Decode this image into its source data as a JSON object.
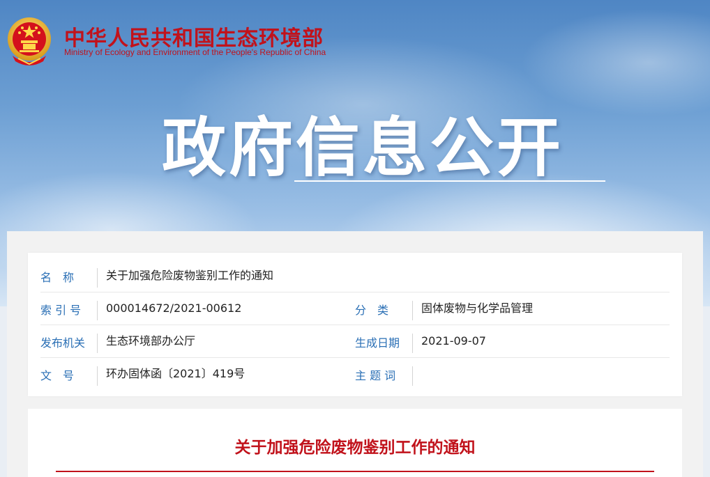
{
  "header": {
    "logo_cn": "中华人民共和国生态环境部",
    "logo_en": "Ministry of Ecology and Environment of the People's Republic of China",
    "emblem_icon": "national-emblem-icon",
    "banner_title": "政府信息公开"
  },
  "meta": {
    "name_label": "名　称",
    "name_value": "关于加强危险废物鉴别工作的通知",
    "index_label": "索 引 号",
    "index_value": "000014672/2021-00612",
    "category_label": "分　类",
    "category_value": "固体废物与化学品管理",
    "issuer_label": "发布机关",
    "issuer_value": "生态环境部办公厅",
    "date_label": "生成日期",
    "date_value": "2021-09-07",
    "doc_no_label": "文　号",
    "doc_no_value": "环办固体函〔2021〕419号",
    "keywords_label": "主 题 词",
    "keywords_value": ""
  },
  "article": {
    "title": "关于加强危险废物鉴别工作的通知"
  },
  "colors": {
    "brand_red": "#c1121b",
    "label_blue": "#2a6fb5",
    "sky_blue": "#6d9fd3"
  }
}
